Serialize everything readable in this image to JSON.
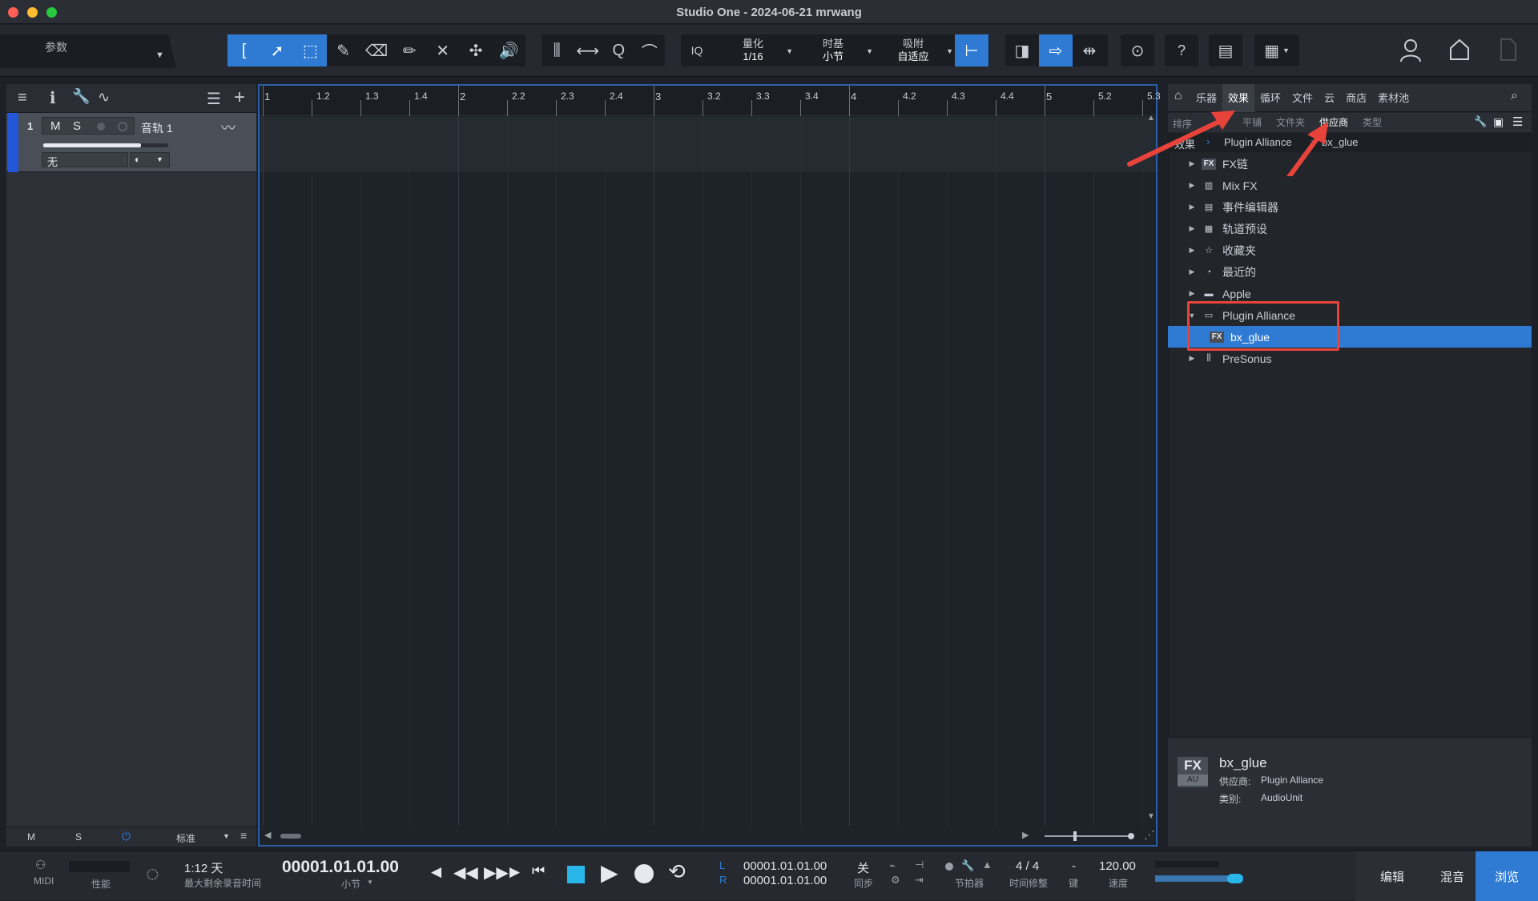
{
  "window": {
    "title": "Studio One - 2024-06-21 mrwang"
  },
  "toolbar": {
    "params_label": "参数",
    "quantize_label": "量化",
    "quantize_value": "1/16",
    "timebase_label": "时基",
    "timebase_value": "小节",
    "snap_label": "吸附",
    "snap_value": "自适应",
    "iq_label": "IQ",
    "help_label": "?"
  },
  "tracks": [
    {
      "number": "1",
      "mute": "M",
      "solo": "S",
      "name": "音轨 1",
      "input": "无"
    }
  ],
  "tracklist_footer": {
    "m": "M",
    "s": "S",
    "mode": "标准"
  },
  "ruler": {
    "ticks": [
      "1",
      "1.2",
      "1.3",
      "1.4",
      "2",
      "2.2",
      "2.3",
      "2.4",
      "3",
      "3.2",
      "3.3",
      "3.4",
      "4",
      "4.2",
      "4.3",
      "4.4",
      "5",
      "5.2",
      "5.3"
    ]
  },
  "browser": {
    "tabs": [
      "乐器",
      "效果",
      "循环",
      "文件",
      "云",
      "商店",
      "素材池"
    ],
    "active_tab": "效果",
    "sort_label": "排序",
    "sort_options": [
      "平铺",
      "文件夹",
      "供应商",
      "类型"
    ],
    "active_sort": "供应商",
    "breadcrumb": [
      "效果",
      "Plugin Alliance",
      "bx_glue"
    ],
    "tree": [
      {
        "label": "FX链",
        "icon": "FX",
        "expanded": false
      },
      {
        "label": "Mix FX",
        "icon": "mixfx",
        "expanded": false
      },
      {
        "label": "事件编辑器",
        "icon": "event",
        "expanded": false
      },
      {
        "label": "轨道预设",
        "icon": "preset",
        "expanded": false
      },
      {
        "label": "收藏夹",
        "icon": "star",
        "expanded": false
      },
      {
        "label": "最近的",
        "icon": "clock",
        "expanded": false
      },
      {
        "label": "Apple",
        "icon": "folder",
        "expanded": false
      },
      {
        "label": "Plugin Alliance",
        "icon": "folder-open",
        "expanded": true
      },
      {
        "label": "bx_glue",
        "icon": "FX",
        "child": true,
        "selected": true
      },
      {
        "label": "PreSonus",
        "icon": "presonus",
        "expanded": false
      }
    ],
    "info": {
      "icon_top": "FX",
      "icon_bottom": "AU",
      "name": "bx_glue",
      "vendor_label": "供应商:",
      "vendor": "Plugin Alliance",
      "category_label": "类别:",
      "category": "AudioUnit"
    }
  },
  "transport": {
    "midi_label": "MIDI",
    "perf_label": "性能",
    "record_time": "1:12 天",
    "record_time_label": "最大剩余录音时间",
    "position": "00001.01.01.00",
    "position_unit": "小节",
    "loop_l_label": "L",
    "loop_r_label": "R",
    "loop_start": "00001.01.01.00",
    "loop_end": "00001.01.01.00",
    "sync_value": "关",
    "sync_label": "同步",
    "metronome_label": "节拍器",
    "signature": "4 / 4",
    "signature_label": "时间修整",
    "key_value": "-",
    "key_label": "键",
    "tempo": "120.00",
    "tempo_label": "速度",
    "edit_label": "编辑",
    "mix_label": "混音",
    "browse_label": "浏览"
  },
  "colors": {
    "accent": "#2f7bd4",
    "annotation": "#e8433a",
    "track_color": "#2456d8"
  }
}
